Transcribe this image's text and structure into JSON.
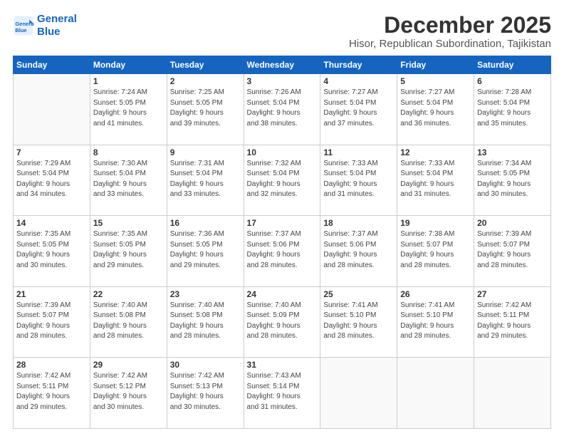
{
  "logo": {
    "line1": "General",
    "line2": "Blue"
  },
  "title": "December 2025",
  "subtitle": "Hisor, Republican Subordination, Tajikistan",
  "days_header": [
    "Sunday",
    "Monday",
    "Tuesday",
    "Wednesday",
    "Thursday",
    "Friday",
    "Saturday"
  ],
  "weeks": [
    [
      {
        "day": "",
        "info": ""
      },
      {
        "day": "1",
        "info": "Sunrise: 7:24 AM\nSunset: 5:05 PM\nDaylight: 9 hours\nand 41 minutes."
      },
      {
        "day": "2",
        "info": "Sunrise: 7:25 AM\nSunset: 5:05 PM\nDaylight: 9 hours\nand 39 minutes."
      },
      {
        "day": "3",
        "info": "Sunrise: 7:26 AM\nSunset: 5:04 PM\nDaylight: 9 hours\nand 38 minutes."
      },
      {
        "day": "4",
        "info": "Sunrise: 7:27 AM\nSunset: 5:04 PM\nDaylight: 9 hours\nand 37 minutes."
      },
      {
        "day": "5",
        "info": "Sunrise: 7:27 AM\nSunset: 5:04 PM\nDaylight: 9 hours\nand 36 minutes."
      },
      {
        "day": "6",
        "info": "Sunrise: 7:28 AM\nSunset: 5:04 PM\nDaylight: 9 hours\nand 35 minutes."
      }
    ],
    [
      {
        "day": "7",
        "info": "Sunrise: 7:29 AM\nSunset: 5:04 PM\nDaylight: 9 hours\nand 34 minutes."
      },
      {
        "day": "8",
        "info": "Sunrise: 7:30 AM\nSunset: 5:04 PM\nDaylight: 9 hours\nand 33 minutes."
      },
      {
        "day": "9",
        "info": "Sunrise: 7:31 AM\nSunset: 5:04 PM\nDaylight: 9 hours\nand 33 minutes."
      },
      {
        "day": "10",
        "info": "Sunrise: 7:32 AM\nSunset: 5:04 PM\nDaylight: 9 hours\nand 32 minutes."
      },
      {
        "day": "11",
        "info": "Sunrise: 7:33 AM\nSunset: 5:04 PM\nDaylight: 9 hours\nand 31 minutes."
      },
      {
        "day": "12",
        "info": "Sunrise: 7:33 AM\nSunset: 5:04 PM\nDaylight: 9 hours\nand 31 minutes."
      },
      {
        "day": "13",
        "info": "Sunrise: 7:34 AM\nSunset: 5:05 PM\nDaylight: 9 hours\nand 30 minutes."
      }
    ],
    [
      {
        "day": "14",
        "info": "Sunrise: 7:35 AM\nSunset: 5:05 PM\nDaylight: 9 hours\nand 30 minutes."
      },
      {
        "day": "15",
        "info": "Sunrise: 7:35 AM\nSunset: 5:05 PM\nDaylight: 9 hours\nand 29 minutes."
      },
      {
        "day": "16",
        "info": "Sunrise: 7:36 AM\nSunset: 5:05 PM\nDaylight: 9 hours\nand 29 minutes."
      },
      {
        "day": "17",
        "info": "Sunrise: 7:37 AM\nSunset: 5:06 PM\nDaylight: 9 hours\nand 28 minutes."
      },
      {
        "day": "18",
        "info": "Sunrise: 7:37 AM\nSunset: 5:06 PM\nDaylight: 9 hours\nand 28 minutes."
      },
      {
        "day": "19",
        "info": "Sunrise: 7:38 AM\nSunset: 5:07 PM\nDaylight: 9 hours\nand 28 minutes."
      },
      {
        "day": "20",
        "info": "Sunrise: 7:39 AM\nSunset: 5:07 PM\nDaylight: 9 hours\nand 28 minutes."
      }
    ],
    [
      {
        "day": "21",
        "info": "Sunrise: 7:39 AM\nSunset: 5:07 PM\nDaylight: 9 hours\nand 28 minutes."
      },
      {
        "day": "22",
        "info": "Sunrise: 7:40 AM\nSunset: 5:08 PM\nDaylight: 9 hours\nand 28 minutes."
      },
      {
        "day": "23",
        "info": "Sunrise: 7:40 AM\nSunset: 5:08 PM\nDaylight: 9 hours\nand 28 minutes."
      },
      {
        "day": "24",
        "info": "Sunrise: 7:40 AM\nSunset: 5:09 PM\nDaylight: 9 hours\nand 28 minutes."
      },
      {
        "day": "25",
        "info": "Sunrise: 7:41 AM\nSunset: 5:10 PM\nDaylight: 9 hours\nand 28 minutes."
      },
      {
        "day": "26",
        "info": "Sunrise: 7:41 AM\nSunset: 5:10 PM\nDaylight: 9 hours\nand 28 minutes."
      },
      {
        "day": "27",
        "info": "Sunrise: 7:42 AM\nSunset: 5:11 PM\nDaylight: 9 hours\nand 29 minutes."
      }
    ],
    [
      {
        "day": "28",
        "info": "Sunrise: 7:42 AM\nSunset: 5:11 PM\nDaylight: 9 hours\nand 29 minutes."
      },
      {
        "day": "29",
        "info": "Sunrise: 7:42 AM\nSunset: 5:12 PM\nDaylight: 9 hours\nand 30 minutes."
      },
      {
        "day": "30",
        "info": "Sunrise: 7:42 AM\nSunset: 5:13 PM\nDaylight: 9 hours\nand 30 minutes."
      },
      {
        "day": "31",
        "info": "Sunrise: 7:43 AM\nSunset: 5:14 PM\nDaylight: 9 hours\nand 31 minutes."
      },
      {
        "day": "",
        "info": ""
      },
      {
        "day": "",
        "info": ""
      },
      {
        "day": "",
        "info": ""
      }
    ]
  ]
}
